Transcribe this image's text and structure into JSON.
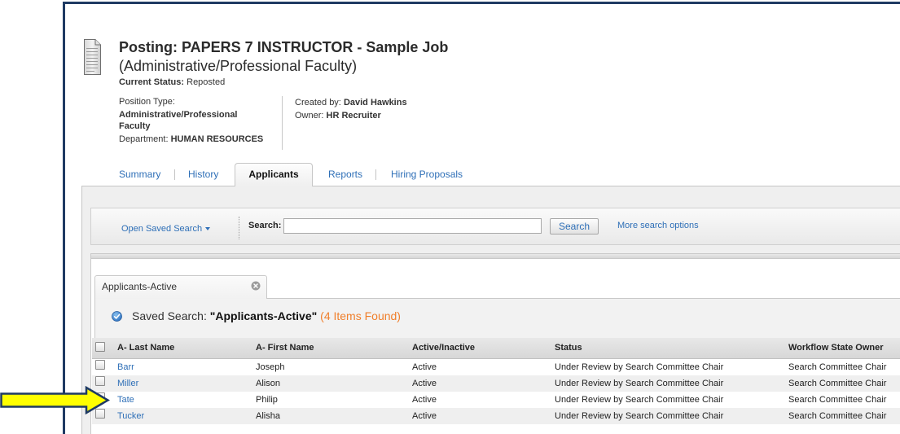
{
  "page": {
    "icon": "document-icon",
    "title": "Posting: PAPERS 7 INSTRUCTOR - Sample Job",
    "subtitle": "(Administrative/Professional Faculty)"
  },
  "status": {
    "label": "Current Status:",
    "value": "Reposted"
  },
  "details": {
    "position_type_label": "Position Type:",
    "position_type_value": "Administrative/Professional Faculty",
    "department_label": "Department:",
    "department_value": "HUMAN RESOURCES",
    "created_by_label": "Created by:",
    "created_by_value": "David Hawkins",
    "owner_label": "Owner:",
    "owner_value": "HR Recruiter"
  },
  "tabs": [
    {
      "label": "Summary",
      "active": false
    },
    {
      "label": "History",
      "active": false
    },
    {
      "label": "Applicants",
      "active": true
    },
    {
      "label": "Reports",
      "active": false
    },
    {
      "label": "Hiring Proposals",
      "active": false
    }
  ],
  "search": {
    "open_saved_label": "Open Saved Search",
    "open_saved_icon": "caret-down-icon",
    "label": "Search:",
    "value": "",
    "button_label": "Search",
    "more_options_label": "More search options"
  },
  "saved_search_tab": {
    "label": "Applicants-Active",
    "close_icon": "close-circle-icon"
  },
  "results": {
    "icon": "check-circle-icon",
    "prefix": "Saved Search:",
    "name": "\"Applicants-Active\"",
    "count": "(4 Items Found)"
  },
  "table": {
    "columns": [
      "A- Last Name",
      "A- First Name",
      "Active/Inactive",
      "Status",
      "Workflow State Owner"
    ],
    "rows": [
      [
        "Barr",
        "Joseph",
        "Active",
        "Under Review by Search Committee Chair",
        "Search Committee Chair"
      ],
      [
        "Miller",
        "Alison",
        "Active",
        "Under Review by Search Committee Chair",
        "Search Committee Chair"
      ],
      [
        "Tate",
        "Philip",
        "Active",
        "Under Review by Search Committee Chair",
        "Search Committee Chair"
      ],
      [
        "Tucker",
        "Alisha",
        "Active",
        "Under Review by Search Committee Chair",
        "Search Committee Chair"
      ]
    ]
  },
  "annotation": {
    "icon": "arrow-right-icon"
  },
  "colors": {
    "frame_border": "#1f3a63",
    "link": "#2e6fb7",
    "count": "#f07f2b",
    "arrow_fill": "#ffff00",
    "arrow_stroke": "#1f3a63",
    "row_alt": "#efefef"
  }
}
